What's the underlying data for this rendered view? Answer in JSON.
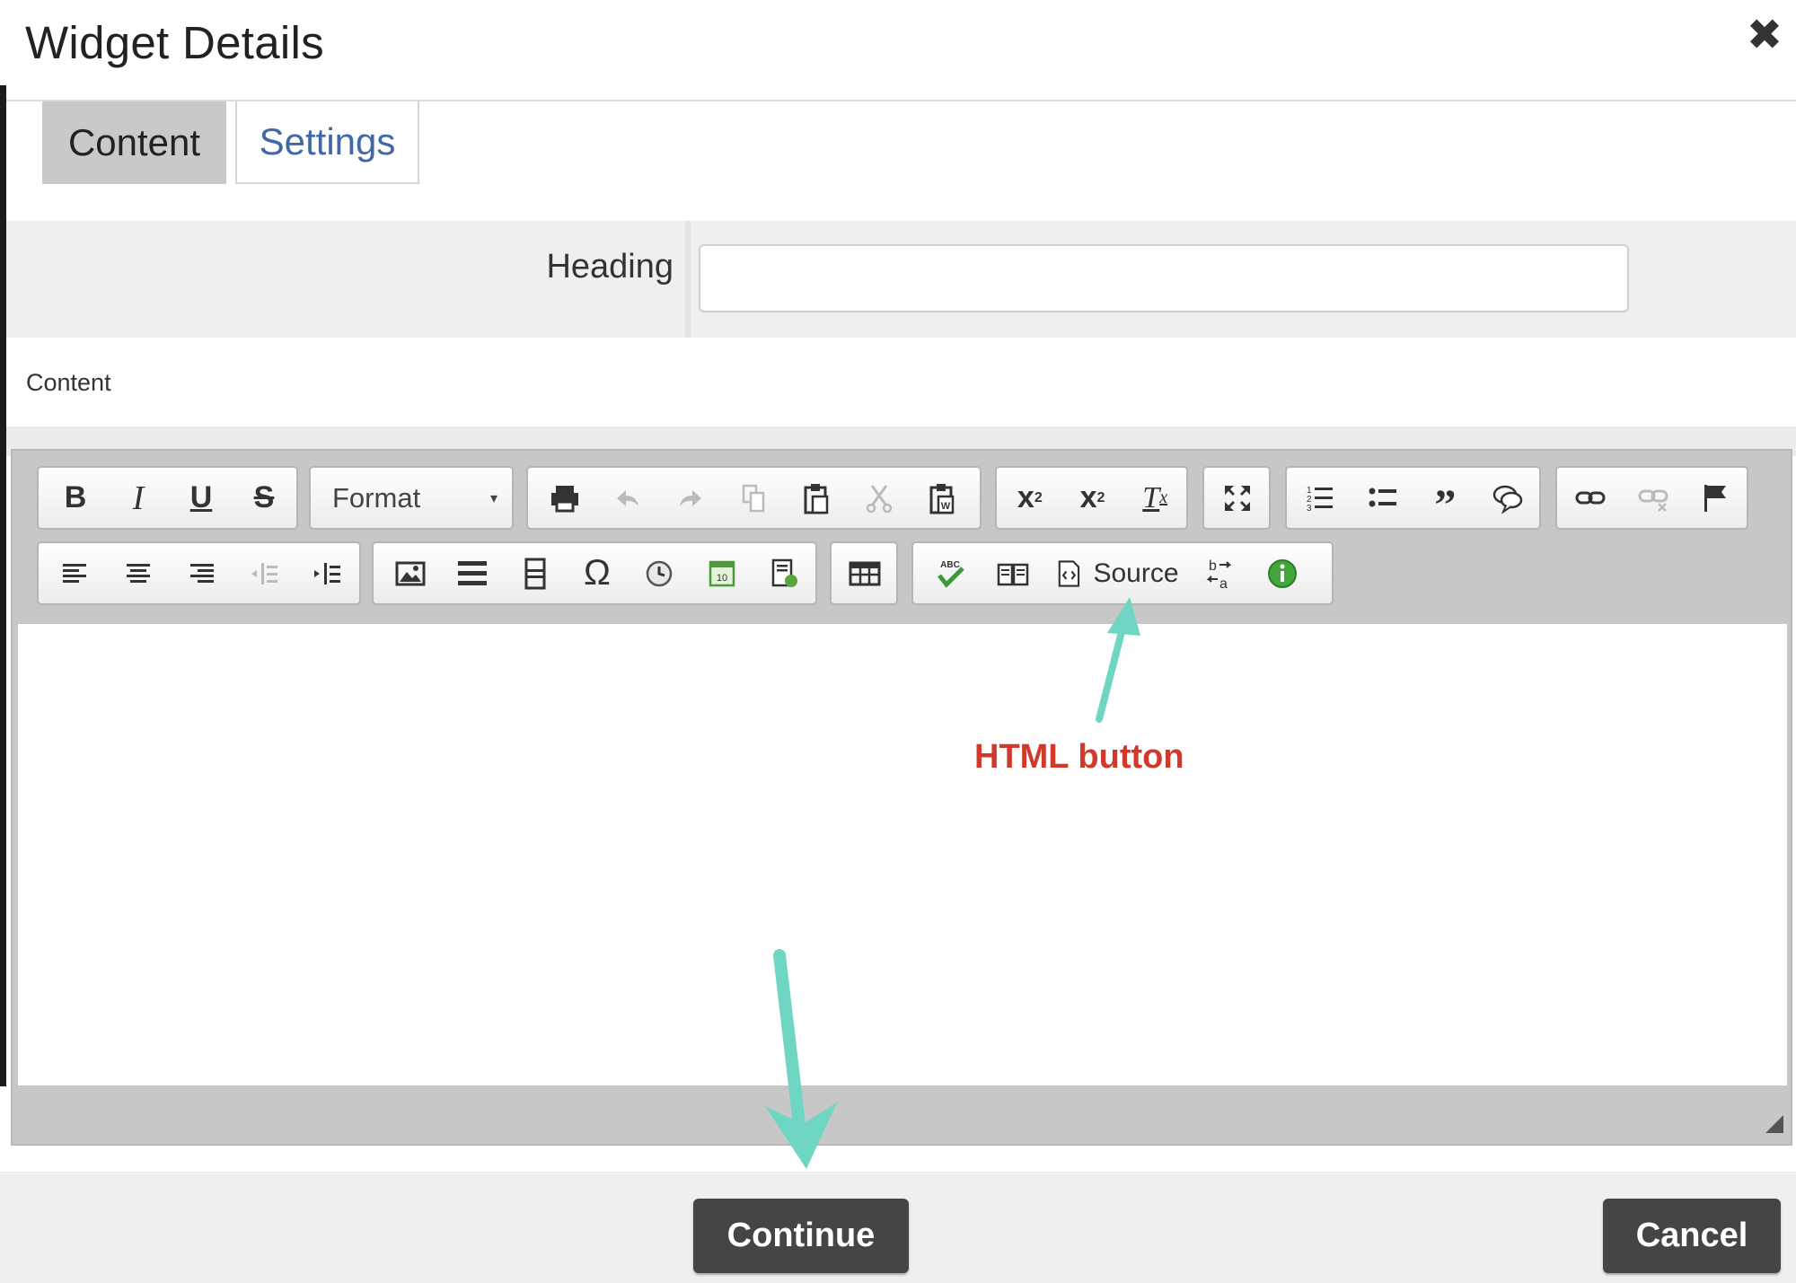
{
  "dialog": {
    "title": "Widget Details",
    "close_icon": "close-icon"
  },
  "tabs": [
    {
      "label": "Content",
      "active": true
    },
    {
      "label": "Settings",
      "active": false
    }
  ],
  "form": {
    "heading_label": "Heading",
    "heading_value": "",
    "content_label": "Content"
  },
  "toolbar": {
    "row1": {
      "basic": [
        "bold-icon",
        "italic-icon",
        "underline-icon",
        "strikethrough-icon"
      ],
      "format_label": "Format",
      "clipboard": [
        "print-icon",
        "undo-icon",
        "redo-icon",
        "copy-icon",
        "paste-icon",
        "cut-icon",
        "paste-word-icon"
      ],
      "script": [
        "subscript-icon",
        "superscript-icon",
        "remove-format-icon"
      ],
      "view": [
        "maximize-icon"
      ],
      "lists": [
        "numbered-list-icon",
        "bulleted-list-icon",
        "blockquote-icon",
        "speech-bubble-icon"
      ],
      "links": [
        "link-icon",
        "unlink-icon",
        "anchor-flag-icon"
      ]
    },
    "row2": {
      "align": [
        "align-left-icon",
        "align-center-icon",
        "align-right-icon",
        "outdent-icon",
        "indent-icon"
      ],
      "insert": [
        "image-icon",
        "horizontal-rule-icon",
        "page-break-icon",
        "special-char-icon",
        "clock-icon",
        "calendar-icon",
        "template-icon"
      ],
      "table": [
        "table-icon"
      ],
      "tools": [
        "spellcheck-icon",
        "book-icon"
      ],
      "source_label": "Source",
      "tools2": [
        "language-direction-icon",
        "info-icon"
      ]
    }
  },
  "annotation": {
    "text": "HTML button",
    "color": "#d03a2c",
    "arrow_color": "#6fd6c4"
  },
  "footer": {
    "continue_label": "Continue",
    "cancel_label": "Cancel"
  }
}
